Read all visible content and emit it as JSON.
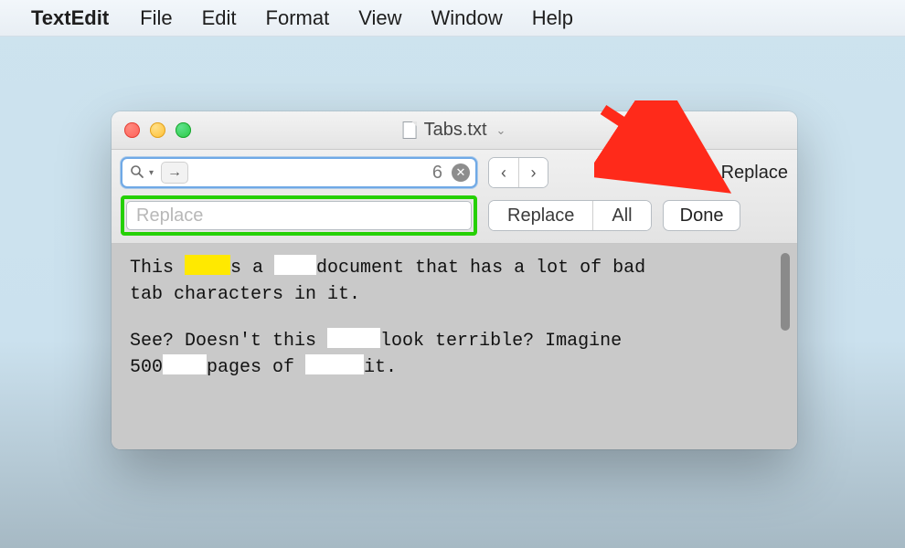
{
  "menubar": {
    "app_name": "TextEdit",
    "items": [
      "File",
      "Edit",
      "Format",
      "View",
      "Window",
      "Help"
    ]
  },
  "window": {
    "title": "Tabs.txt"
  },
  "findbar": {
    "match_count": "6",
    "nav_prev": "‹",
    "nav_next": "›",
    "replace_checkbox_label": "Replace",
    "replace_placeholder": "Replace",
    "replace_button": "Replace",
    "replace_all_button": "All",
    "done_button": "Done"
  },
  "document": {
    "line1_a": "This ",
    "line1_b": "s a ",
    "line1_c": "document that has a lot of bad",
    "line2": "tab characters in it.",
    "line3_a": "See? Doesn't this ",
    "line3_b": "look terrible? Imagine",
    "line4_a": "500",
    "line4_b": "pages of ",
    "line4_c": "it."
  }
}
